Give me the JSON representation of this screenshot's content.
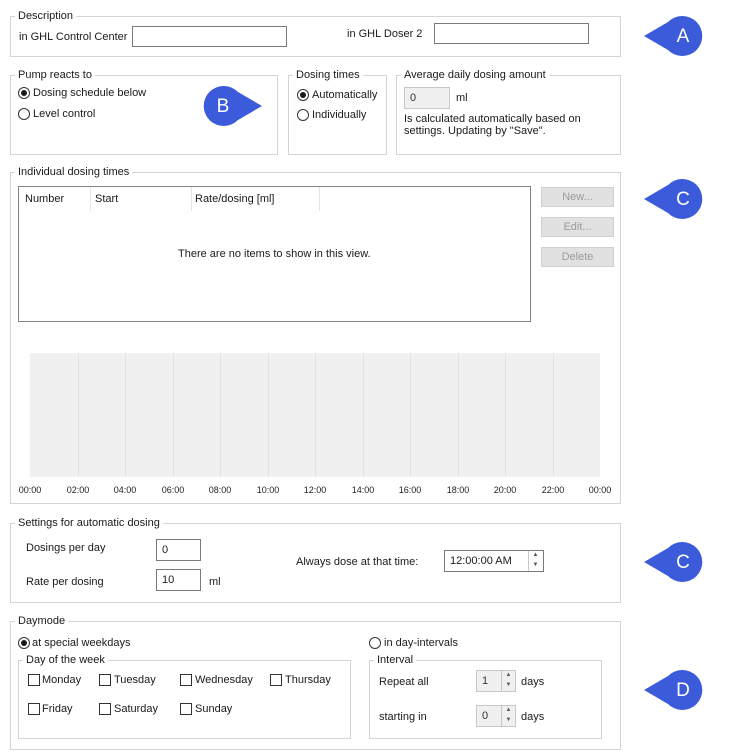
{
  "description": {
    "legend": "Description",
    "control_center_label": "in GHL Control Center",
    "control_center_value": "",
    "doser_label": "in GHL Doser 2",
    "doser_value": ""
  },
  "pump": {
    "legend": "Pump reacts to",
    "options": [
      "Dosing schedule below",
      "Level control"
    ],
    "selected": 0
  },
  "dosing_times": {
    "legend": "Dosing times",
    "options": [
      "Automatically",
      "Individually"
    ],
    "selected": 0
  },
  "average": {
    "legend": "Average daily dosing amount",
    "value": "0",
    "unit": "ml",
    "note_line1": "Is calculated automatically based on",
    "note_line2": "settings. Updating by \"Save\"."
  },
  "individual": {
    "legend": "Individual dosing times",
    "columns": [
      "Number",
      "Start",
      "Rate/dosing [ml]"
    ],
    "empty_text": "There are no items to show in this view.",
    "buttons": {
      "new": "New...",
      "edit": "Edit...",
      "delete": "Delete"
    },
    "timeline_ticks": [
      "00:00",
      "02:00",
      "04:00",
      "06:00",
      "08:00",
      "10:00",
      "12:00",
      "14:00",
      "16:00",
      "18:00",
      "20:00",
      "22:00",
      "00:00"
    ]
  },
  "auto": {
    "legend": "Settings for automatic dosing",
    "dosings_label": "Dosings per day",
    "dosings_value": "0",
    "rate_label": "Rate per dosing",
    "rate_value": "10",
    "rate_unit": "ml",
    "time_label": "Always dose at that time:",
    "time_value": "12:00:00 AM"
  },
  "daymode": {
    "legend": "Daymode",
    "weekdays_option": "at special weekdays",
    "intervals_option": "in day-intervals",
    "selected": "weekdays",
    "week_legend": "Day of the week",
    "days": [
      "Monday",
      "Tuesday",
      "Wednesday",
      "Thursday",
      "Friday",
      "Saturday",
      "Sunday"
    ],
    "interval_legend": "Interval",
    "repeat_label": "Repeat all",
    "repeat_value": "1",
    "repeat_unit": "days",
    "starting_label": "starting in",
    "starting_value": "0",
    "starting_unit": "days"
  },
  "callouts": [
    "A",
    "B",
    "C",
    "C",
    "D"
  ],
  "colors": {
    "callout": "#3b5bdb",
    "chart_bg": "#f0f0f0",
    "group_border": "#d5d5d5"
  }
}
